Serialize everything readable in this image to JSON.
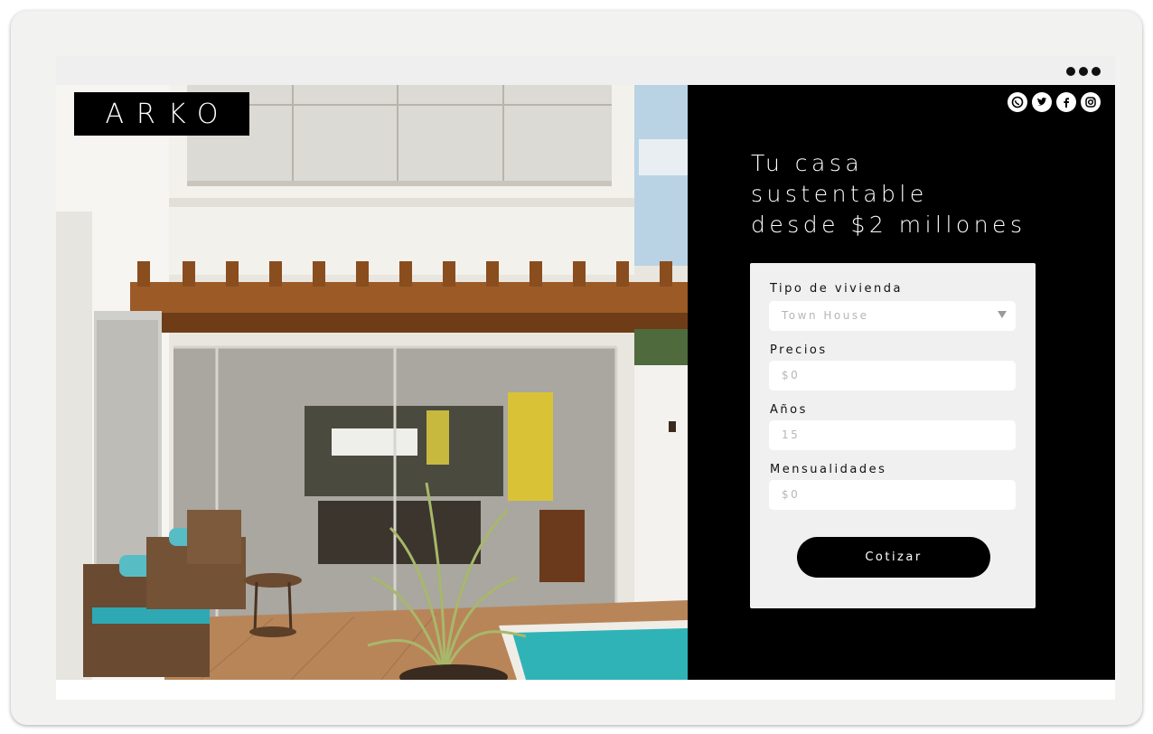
{
  "brand": {
    "logo_text": "ARKO"
  },
  "window": {
    "menu_icon": "more-dots-icon"
  },
  "hero": {
    "image_description_icon": "house-photo"
  },
  "social": {
    "icons": [
      "whatsapp-icon",
      "twitter-icon",
      "facebook-icon",
      "instagram-icon"
    ]
  },
  "headline": {
    "line1": "Tu casa",
    "line2": "sustentable",
    "line3": "desde $2 millones"
  },
  "form": {
    "housing_type": {
      "label": "Tipo de vivienda",
      "value": "Town House"
    },
    "price": {
      "label": "Precios",
      "value": "$0"
    },
    "years": {
      "label": "Años",
      "value": "15"
    },
    "monthly": {
      "label": "Mensualidades",
      "value": "$0"
    },
    "submit_label": "Cotizar"
  },
  "colors": {
    "panel_bg": "#000000",
    "card_bg": "#f0f0f0",
    "accent": "#000000"
  }
}
